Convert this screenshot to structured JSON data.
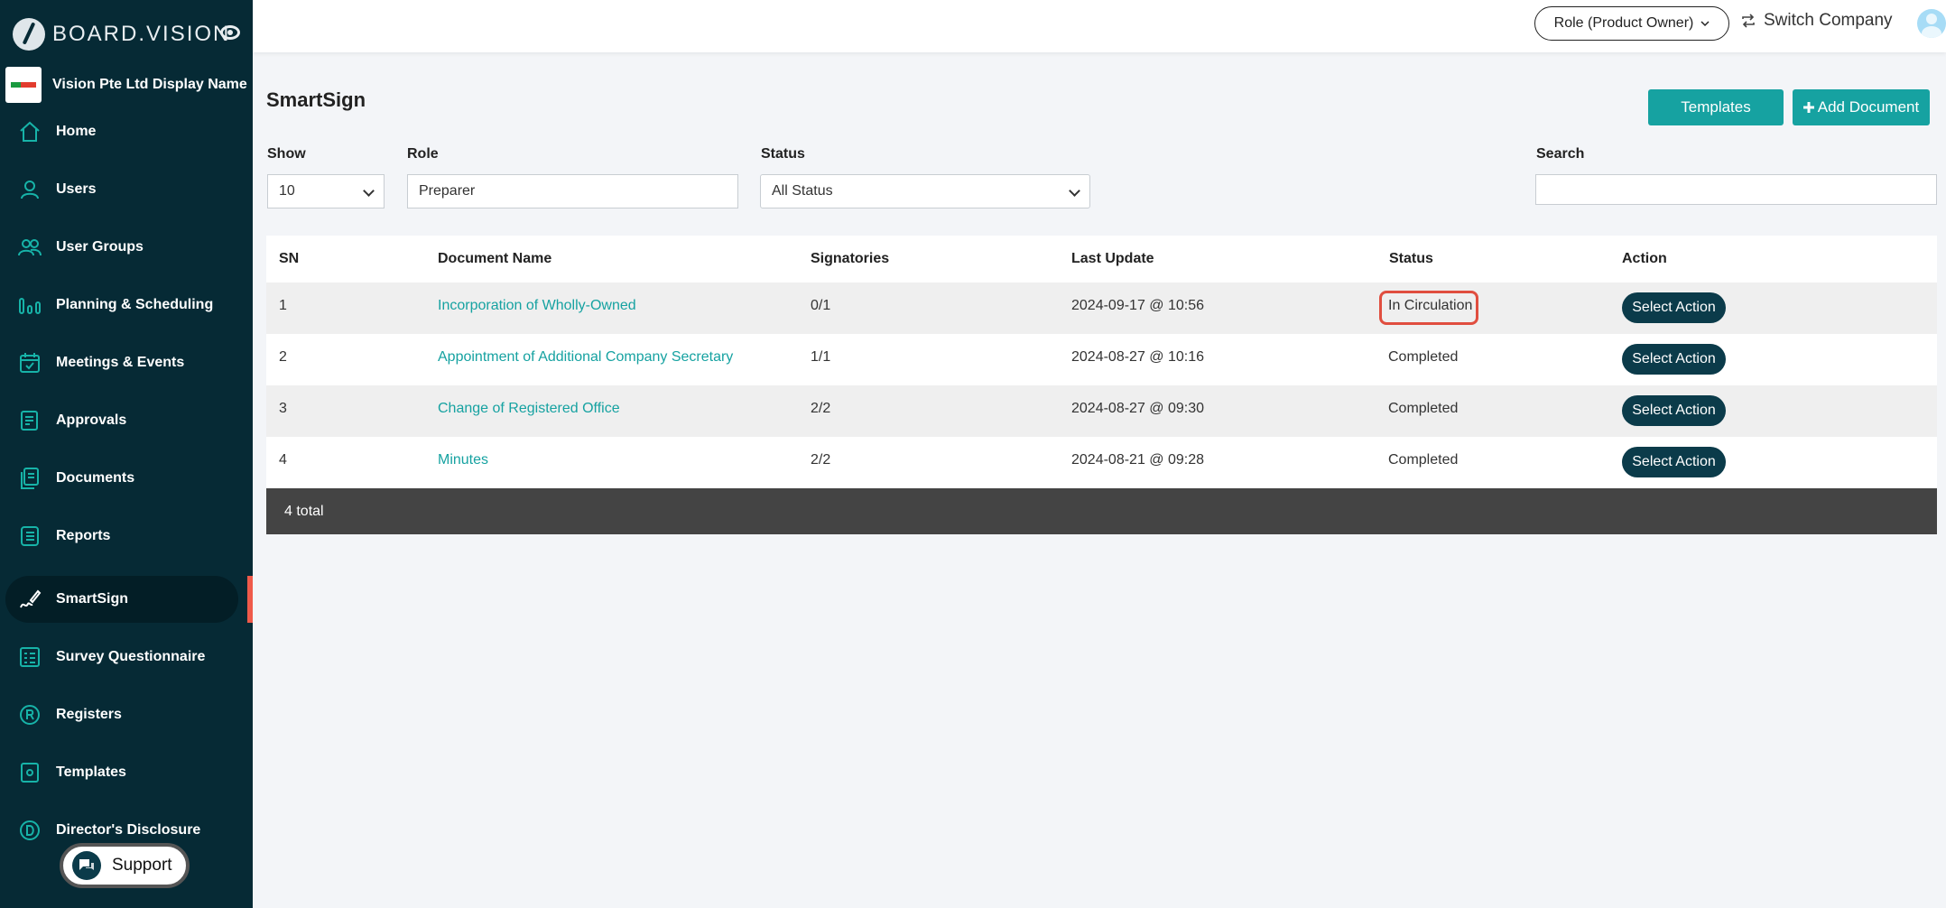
{
  "brand": {
    "name": "BOARD.VISION"
  },
  "company": {
    "name": "Vision Pte Ltd Display Name"
  },
  "sidebar": {
    "items": [
      {
        "label": "Home",
        "icon": "home-icon"
      },
      {
        "label": "Users",
        "icon": "user-icon"
      },
      {
        "label": "User Groups",
        "icon": "user-group-icon"
      },
      {
        "label": "Planning & Scheduling",
        "icon": "bar-chart-icon"
      },
      {
        "label": "Meetings & Events",
        "icon": "calendar-icon"
      },
      {
        "label": "Approvals",
        "icon": "approval-doc-icon"
      },
      {
        "label": "Documents",
        "icon": "documents-icon"
      },
      {
        "label": "Reports",
        "icon": "report-icon"
      },
      {
        "label": "SmartSign",
        "icon": "signature-pen-icon",
        "active": true
      },
      {
        "label": "Survey Questionnaire",
        "icon": "survey-icon"
      },
      {
        "label": "Registers",
        "icon": "registered-icon"
      },
      {
        "label": "Templates",
        "icon": "template-icon"
      },
      {
        "label": "Director's Disclosure",
        "icon": "disclosure-d-icon"
      }
    ],
    "support_label": "Support"
  },
  "topbar": {
    "role_label": "Role (Product Owner)",
    "switch_label": "Switch Company"
  },
  "page": {
    "title": "SmartSign",
    "templates_label": "Templates",
    "add_document_label": "Add Document"
  },
  "filters": {
    "show_label": "Show",
    "show_value": "10",
    "role_label": "Role",
    "role_value": "Preparer",
    "status_label": "Status",
    "status_value": "All Status",
    "search_label": "Search",
    "search_value": ""
  },
  "table": {
    "headers": [
      "SN",
      "Document Name",
      "Signatories",
      "Last Update",
      "Status",
      "Action"
    ],
    "rows": [
      {
        "sn": "1",
        "name": "Incorporation of Wholly-Owned",
        "signatories": "0/1",
        "updated": "2024-09-17 @ 10:56",
        "status": "In Circulation",
        "action": "Select Action"
      },
      {
        "sn": "2",
        "name": "Appointment of Additional Company Secretary",
        "signatories": "1/1",
        "updated": "2024-08-27 @ 10:16",
        "status": "Completed",
        "action": "Select Action"
      },
      {
        "sn": "3",
        "name": "Change of Registered Office",
        "signatories": "2/2",
        "updated": "2024-08-27 @ 09:30",
        "status": "Completed",
        "action": "Select Action"
      },
      {
        "sn": "4",
        "name": "Minutes",
        "signatories": "2/2",
        "updated": "2024-08-21 @ 09:28",
        "status": "Completed",
        "action": "Select Action"
      }
    ],
    "total": "4 total"
  },
  "colors": {
    "sidebar_bg": "#062a35",
    "accent_teal": "#16a2a1",
    "action_button": "#0b3b4a",
    "highlight_red": "#e04e3f"
  }
}
